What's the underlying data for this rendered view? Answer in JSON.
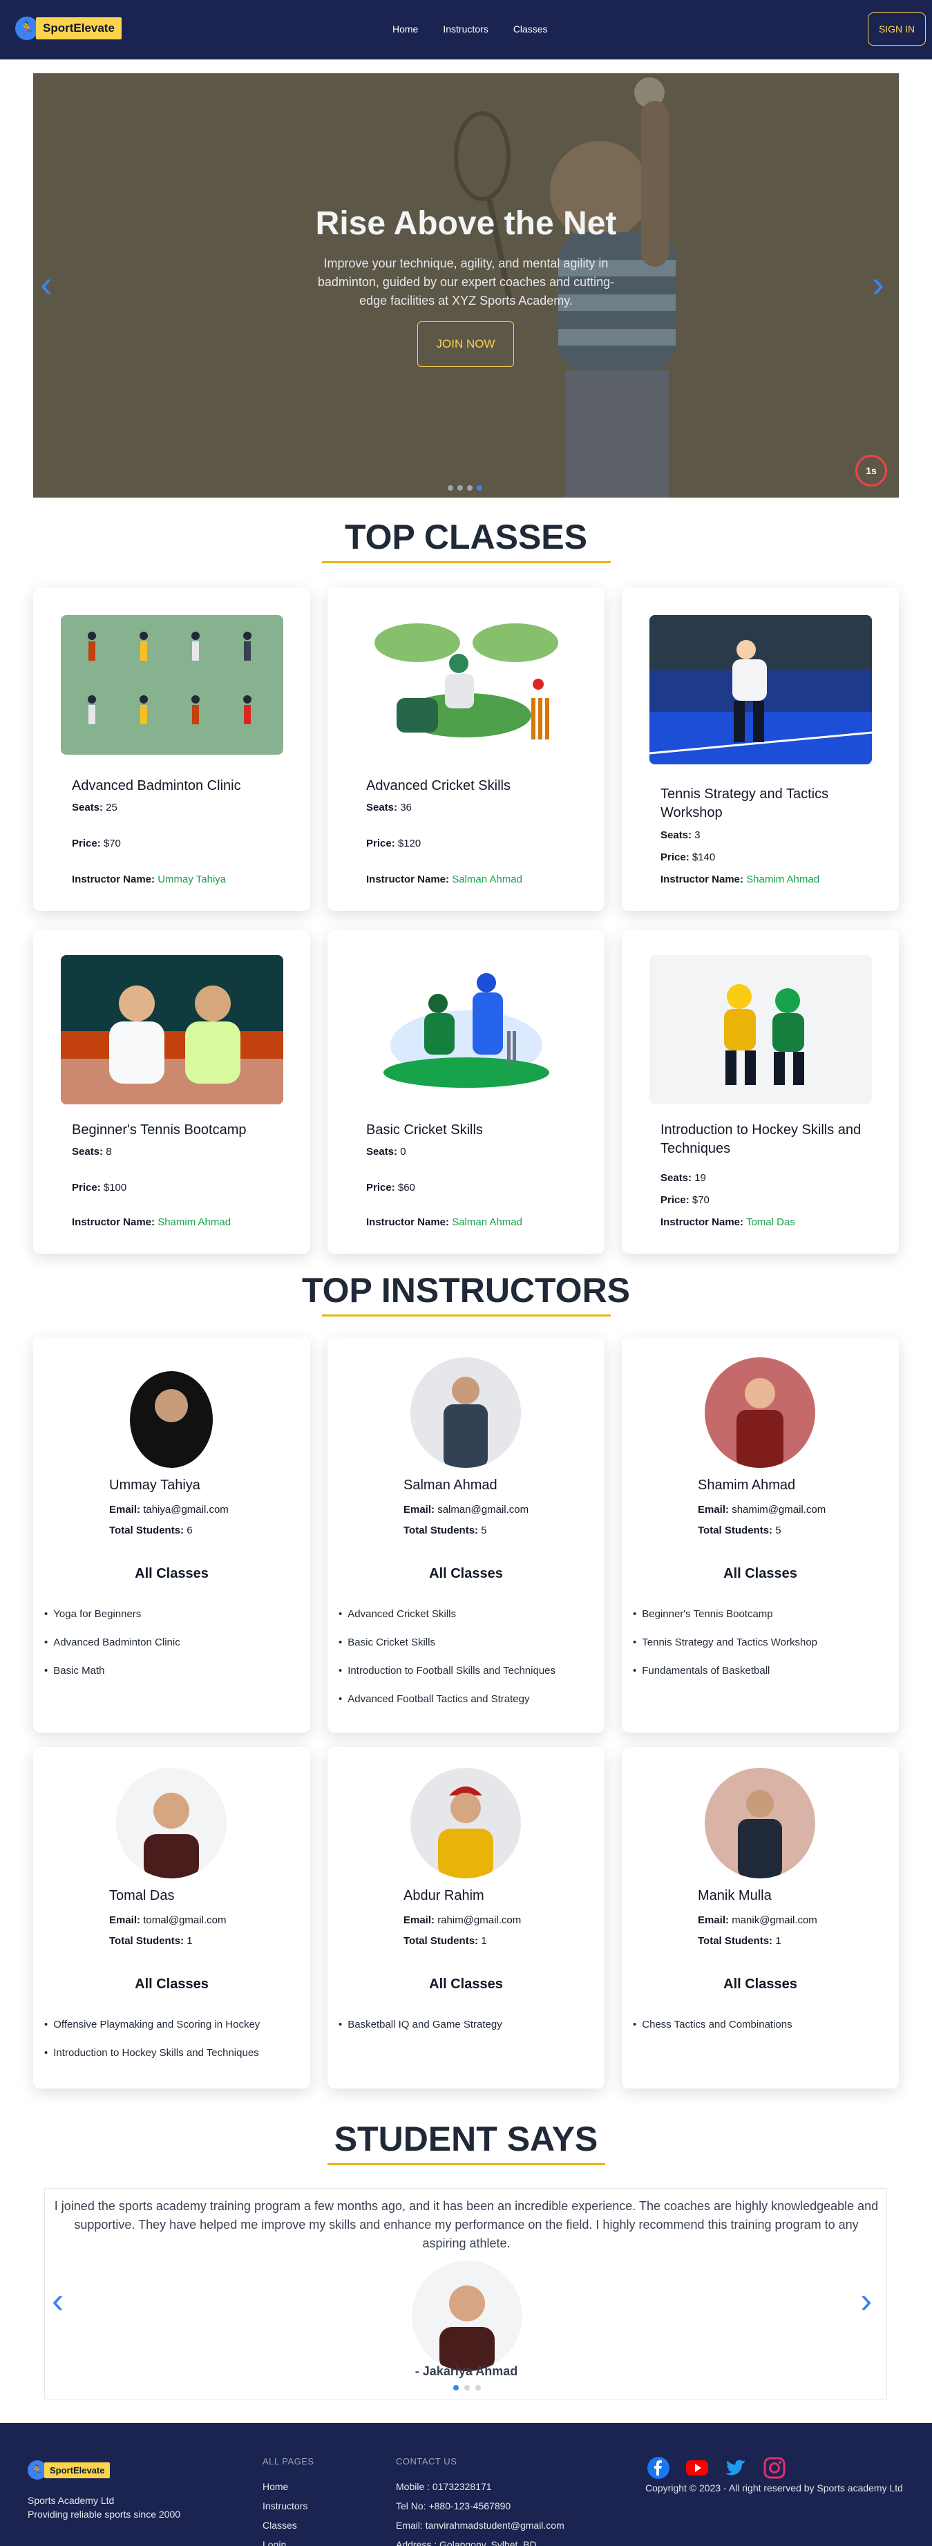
{
  "navbar": {
    "brand": "SportElevate",
    "links": [
      "Home",
      "Instructors",
      "Classes"
    ],
    "signin_label": "SIGN IN",
    "colors": {
      "background": "#1b2450",
      "accent": "#fcd34d"
    }
  },
  "hero": {
    "title": "Rise Above the Net",
    "subtitle": "Improve your technique, agility, and mental agility in badminton, guided by our expert coaches and cutting-edge facilities at XYZ Sports Academy.",
    "button_label": "JOIN NOW",
    "timer": "1s",
    "slide_count": 4,
    "active_slide": 4
  },
  "top_classes": {
    "heading": "TOP CLASSES",
    "seats_label": "Seats:",
    "price_label": "Price:",
    "instructor_label": "Instructor Name:",
    "items": [
      {
        "title": "Advanced Badminton Clinic",
        "seats": "25",
        "price": "$70",
        "instructor": "Ummay Tahiya",
        "image": "badminton-illustration"
      },
      {
        "title": "Advanced Cricket Skills",
        "seats": "36",
        "price": "$120",
        "instructor": "Salman Ahmad",
        "image": "cricket-illustration"
      },
      {
        "title": "Tennis Strategy and Tactics Workshop",
        "seats": "3",
        "price": "$140",
        "instructor": "Shamim Ahmad",
        "image": "tennis-court-photo"
      },
      {
        "title": "Beginner's Tennis Bootcamp",
        "seats": "8",
        "price": "$100",
        "instructor": "Shamim Ahmad",
        "image": "tennis-players-photo"
      },
      {
        "title": "Basic Cricket Skills",
        "seats": "0",
        "price": "$60",
        "instructor": "Salman Ahmad",
        "image": "cricket-players-illustration"
      },
      {
        "title": "Introduction to Hockey Skills and Techniques",
        "seats": "19",
        "price": "$70",
        "instructor": "Tomal Das",
        "image": "hockey-kids-photo"
      }
    ]
  },
  "top_instructors": {
    "heading": "TOP INSTRUCTORS",
    "email_label": "Email:",
    "students_label": "Total Students:",
    "all_classes_label": "All Classes",
    "items": [
      {
        "name": "Ummay Tahiya",
        "email": "tahiya@gmail.com",
        "students": "6",
        "classes": [
          "Yoga for Beginners",
          "Advanced Badminton Clinic",
          "Basic Math"
        ]
      },
      {
        "name": "Salman Ahmad",
        "email": "salman@gmail.com",
        "students": "5",
        "classes": [
          "Advanced Cricket Skills",
          "Basic Cricket Skills",
          "Introduction to Football Skills and Techniques",
          "Advanced Football Tactics and Strategy"
        ]
      },
      {
        "name": "Shamim Ahmad",
        "email": "shamim@gmail.com",
        "students": "5",
        "classes": [
          "Beginner's Tennis Bootcamp",
          "Tennis Strategy and Tactics Workshop",
          "Fundamentals of Basketball"
        ]
      },
      {
        "name": "Tomal Das",
        "email": "tomal@gmail.com",
        "students": "1",
        "classes": [
          "Offensive Playmaking and Scoring in Hockey",
          "Introduction to Hockey Skills and Techniques"
        ]
      },
      {
        "name": "Abdur Rahim",
        "email": "rahim@gmail.com",
        "students": "1",
        "classes": [
          "Basketball IQ and Game Strategy"
        ]
      },
      {
        "name": "Manik Mulla",
        "email": "manik@gmail.com",
        "students": "1",
        "classes": [
          "Chess Tactics and Combinations"
        ]
      }
    ]
  },
  "testimonials": {
    "heading": "STUDENT SAYS",
    "quote": "I joined the sports academy training program a few months ago, and it has been an incredible experience. The coaches are highly knowledgeable and supportive. They have helped me improve my skills and enhance my performance on the field. I highly recommend this training program to any aspiring athlete.",
    "author": "- Jakariya Ahmad",
    "slide_count": 3,
    "active_slide": 1
  },
  "footer": {
    "brand": "SportElevate",
    "company": "Sports Academy Ltd",
    "tagline": "Providing reliable sports since 2000",
    "pages_heading": "ALL PAGES",
    "pages": [
      "Home",
      "Instructors",
      "Classes",
      "Login"
    ],
    "contact_heading": "CONTACT US",
    "contact": [
      "Mobile : 01732328171",
      "Tel No: +880-123-4567890",
      "Email: tanvirahmadstudent@gmail.com",
      "Address : Golapgony, Sylhet, BD"
    ],
    "social": [
      "facebook-icon",
      "youtube-icon",
      "twitter-icon",
      "instagram-icon"
    ],
    "copyright": "Copyright © 2023 - All right reserved by Sports academy Ltd"
  }
}
